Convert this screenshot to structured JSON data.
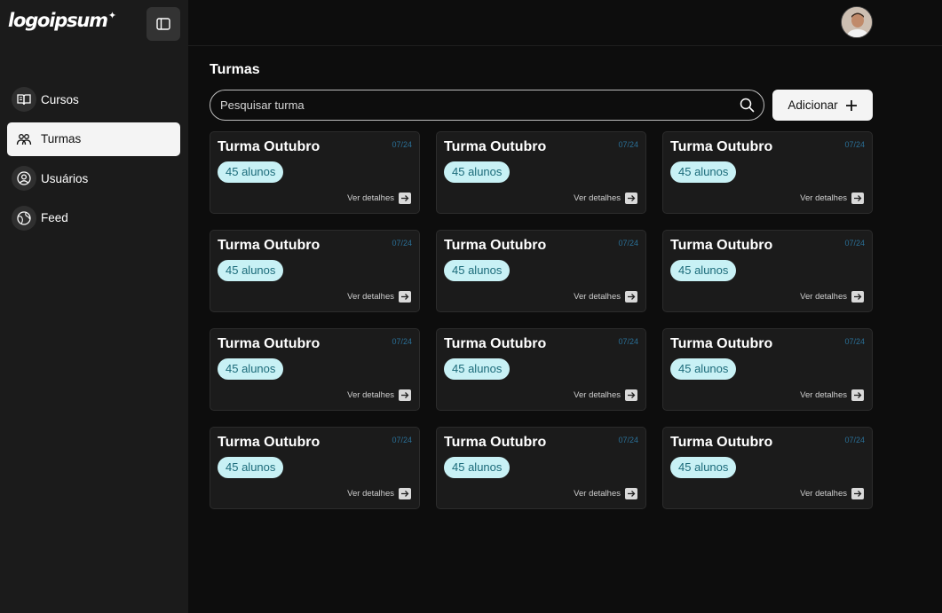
{
  "sidebar": {
    "logo": "logoipsum",
    "items": [
      {
        "label": "Cursos",
        "icon": "book-icon",
        "active": false
      },
      {
        "label": "Turmas",
        "icon": "users-group-icon",
        "active": true
      },
      {
        "label": "Usuários",
        "icon": "user-icon",
        "active": false
      },
      {
        "label": "Feed",
        "icon": "globe-icon",
        "active": false
      }
    ]
  },
  "main": {
    "title": "Turmas",
    "search_placeholder": "Pesquisar turma",
    "add_label": "Adicionar",
    "cards": [
      {
        "title": "Turma Outubro",
        "date": "07/24",
        "badge": "45 alunos",
        "link": "Ver detalhes"
      },
      {
        "title": "Turma Outubro",
        "date": "07/24",
        "badge": "45 alunos",
        "link": "Ver detalhes"
      },
      {
        "title": "Turma Outubro",
        "date": "07/24",
        "badge": "45 alunos",
        "link": "Ver detalhes"
      },
      {
        "title": "Turma Outubro",
        "date": "07/24",
        "badge": "45 alunos",
        "link": "Ver detalhes"
      },
      {
        "title": "Turma Outubro",
        "date": "07/24",
        "badge": "45 alunos",
        "link": "Ver detalhes"
      },
      {
        "title": "Turma Outubro",
        "date": "07/24",
        "badge": "45 alunos",
        "link": "Ver detalhes"
      },
      {
        "title": "Turma Outubro",
        "date": "07/24",
        "badge": "45 alunos",
        "link": "Ver detalhes"
      },
      {
        "title": "Turma Outubro",
        "date": "07/24",
        "badge": "45 alunos",
        "link": "Ver detalhes"
      },
      {
        "title": "Turma Outubro",
        "date": "07/24",
        "badge": "45 alunos",
        "link": "Ver detalhes"
      },
      {
        "title": "Turma Outubro",
        "date": "07/24",
        "badge": "45 alunos",
        "link": "Ver detalhes"
      },
      {
        "title": "Turma Outubro",
        "date": "07/24",
        "badge": "45 alunos",
        "link": "Ver detalhes"
      },
      {
        "title": "Turma Outubro",
        "date": "07/24",
        "badge": "45 alunos",
        "link": "Ver detalhes"
      }
    ]
  },
  "colors": {
    "background": "#0d0d0d",
    "sidebar": "#1b1b1b",
    "card": "#1b1b1b",
    "badge_bg": "#c8f1f5",
    "badge_text": "#1c6b7a",
    "date_text": "#2a6f96",
    "active_item": "#f4f4f4"
  }
}
